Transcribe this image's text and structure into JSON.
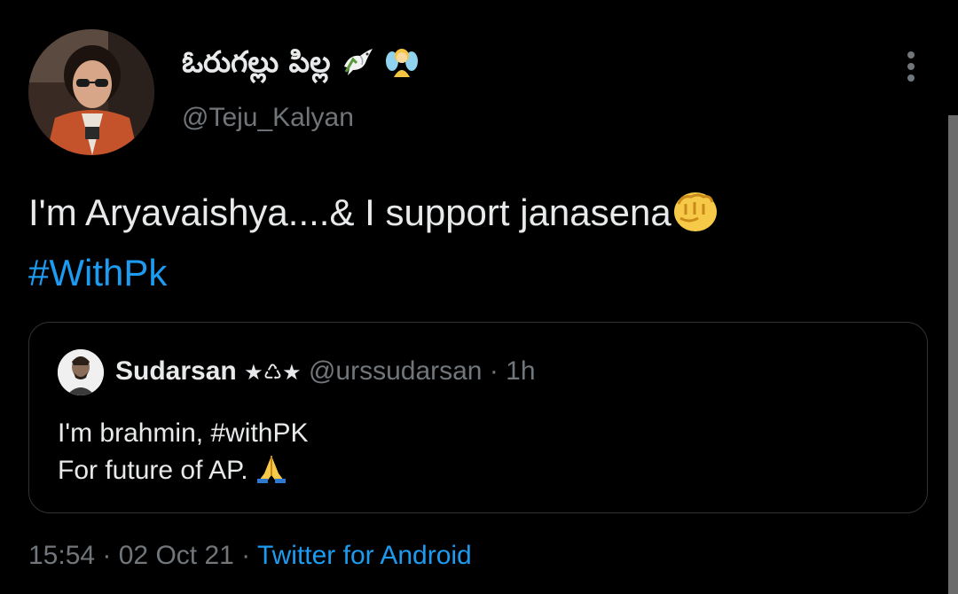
{
  "author": {
    "display_name": "ఓరుగల్లు పిల్ల",
    "username": "@Teju_Kalyan",
    "avatar_icon": "profile-photo"
  },
  "tweet": {
    "text_line1": "I'm Aryavaishya....& I support janasena",
    "hashtag": "#WithPk"
  },
  "quote": {
    "name": "Sudarsan",
    "name_decoration": "★♺★",
    "handle": "@urssudarsan",
    "time": "· 1h",
    "line1": "I'm brahmin, #withPK",
    "line2": "For future of AP."
  },
  "meta": {
    "time": "15:54",
    "sep1": " · ",
    "date": "02 Oct 21",
    "sep2": " · ",
    "source": "Twitter for Android"
  },
  "colors": {
    "background": "#000000",
    "text": "#e7e9ea",
    "muted": "#71767b",
    "link": "#1d9bf0",
    "border": "#2f3336"
  }
}
